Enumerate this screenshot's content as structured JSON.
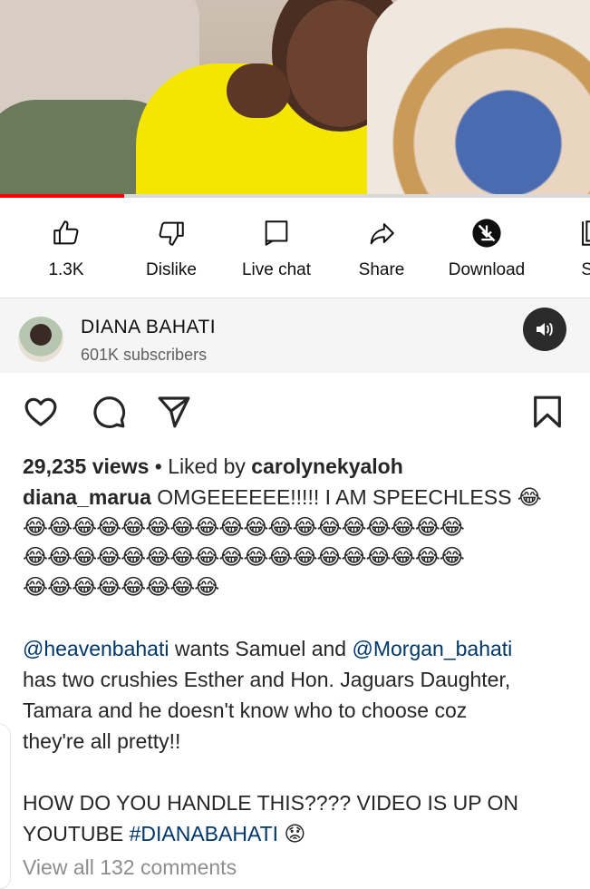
{
  "video": {
    "progress_fraction": 0.21
  },
  "actions": [
    {
      "key": "like",
      "label": "1.3K",
      "icon": "thumbs-up-icon"
    },
    {
      "key": "dislike",
      "label": "Dislike",
      "icon": "thumbs-down-icon"
    },
    {
      "key": "live_chat",
      "label": "Live chat",
      "icon": "live-chat-icon"
    },
    {
      "key": "share",
      "label": "Share",
      "icon": "share-arrow-icon"
    },
    {
      "key": "download",
      "label": "Download",
      "icon": "download-blocked-icon"
    },
    {
      "key": "save",
      "label": "Sa",
      "icon": "save-playlist-icon"
    }
  ],
  "channel": {
    "name": "DIANA BAHATI",
    "subscribers": "601K subscribers",
    "volume_icon": "volume-icon"
  },
  "post": {
    "views": "29,235 views",
    "liked_by_prefix": " • Liked by ",
    "liked_by_user": "carolynekyaloh",
    "caption_user": "diana_marua",
    "caption_text": " OMGEEEEEE!!!!! I AM SPEECHLESS 😂",
    "emoji_row_1": "😂😂😂😂😂😂😂😂😂😂😂😂😂😂😂😂😂😂",
    "emoji_row_2": "😂😂😂😂😂😂😂😂😂😂😂😂😂😂😂😂😂😂",
    "emoji_row_3": "😂😂😂😂😂😂😂😂",
    "mention_1": "@heavenbahati",
    "text_1": "  wants Samuel and ",
    "mention_2": "@Morgan_bahati",
    "text_2": "has two crushies Esther and Hon. Jaguars Daughter,",
    "text_3": "Tamara and he doesn't know who to choose coz",
    "text_4": "they're all pretty!!",
    "text_5": "HOW DO YOU HANDLE THIS???? VIDEO IS UP ON",
    "text_6_prefix": "YOUTUBE ",
    "hashtag": "#DIANABAHATI",
    "text_6_suffix": " 😟",
    "view_all": "View all 132 comments"
  },
  "colors": {
    "progress": "#ff0000",
    "mention": "#00376b",
    "muted": "#8e8e8e"
  }
}
